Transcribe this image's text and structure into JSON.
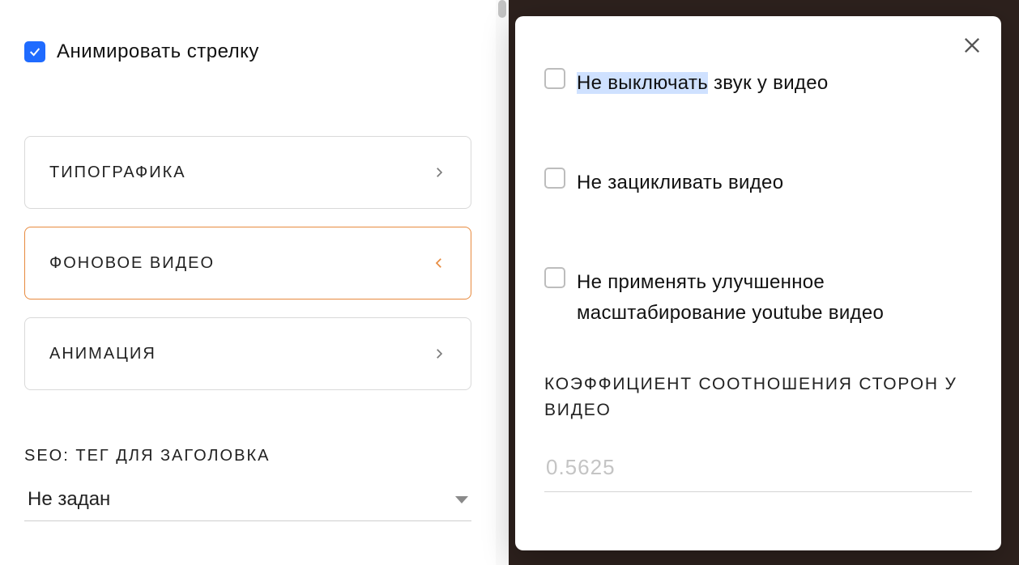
{
  "left": {
    "animate_arrow": {
      "label": "Анимировать стрелку",
      "checked": true
    },
    "accordion": {
      "typography": "ТИПОГРАФИКА",
      "bg_video": "ФОНОВОЕ ВИДЕО",
      "animation": "АНИМАЦИЯ",
      "active_index": 1
    },
    "seo": {
      "label": "SEO: ТЕГ ДЛЯ ЗАГОЛОВКА",
      "value": "Не задан"
    }
  },
  "popup": {
    "options": {
      "no_mute": {
        "label_pre_highlight": "Не выключать",
        "label_post": " звук у видео",
        "checked": false
      },
      "no_loop": {
        "label": "Не зацикливать видео",
        "checked": false
      },
      "no_scale": {
        "label": "Не применять улучшенное масштабирование youtube видео",
        "checked": false
      }
    },
    "ratio": {
      "label": "КОЭФФИЦИЕНТ СООТНОШЕНИЯ СТОРОН У ВИДЕО",
      "placeholder": "0.5625",
      "value": ""
    }
  }
}
